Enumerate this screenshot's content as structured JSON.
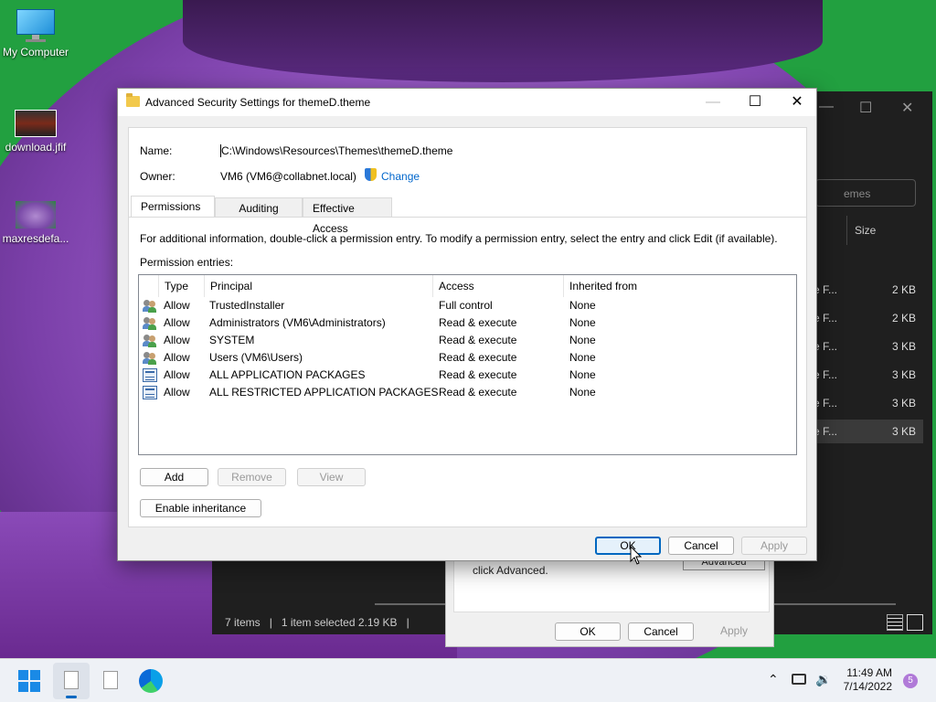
{
  "desktop": {
    "icons": [
      {
        "label": "My Computer"
      },
      {
        "label": "download.jfif"
      },
      {
        "label": "maxresdefa..."
      }
    ]
  },
  "explorer": {
    "search_placeholder": "emes",
    "size_header": "Size",
    "rows": [
      {
        "type": "e F...",
        "size": "2 KB"
      },
      {
        "type": "e F...",
        "size": "2 KB"
      },
      {
        "type": "e F...",
        "size": "3 KB"
      },
      {
        "type": "e F...",
        "size": "3 KB"
      },
      {
        "type": "e F...",
        "size": "3 KB"
      },
      {
        "type": "e F...",
        "size": "3 KB"
      }
    ],
    "status": {
      "items": "7 items",
      "selected": "1 item selected  2.19 KB"
    }
  },
  "properties": {
    "hint": "click Advanced.",
    "advanced_label": "Advanced",
    "ok_label": "OK",
    "cancel_label": "Cancel",
    "apply_label": "Apply"
  },
  "dialog": {
    "title": "Advanced Security Settings for themeD.theme",
    "name_label": "Name:",
    "name_value": "C:\\Windows\\Resources\\Themes\\themeD.theme",
    "owner_label": "Owner:",
    "owner_value": "VM6 (VM6@collabnet.local)",
    "change_label": "Change",
    "tabs": [
      "Permissions",
      "Auditing",
      "Effective Access"
    ],
    "info_text": "For additional information, double-click a permission entry. To modify a permission entry, select the entry and click Edit (if available).",
    "entries_label": "Permission entries:",
    "columns": [
      "Type",
      "Principal",
      "Access",
      "Inherited from"
    ],
    "entries": [
      {
        "icon": "users-icon",
        "type": "Allow",
        "principal": "TrustedInstaller",
        "access": "Full control",
        "inherited": "None"
      },
      {
        "icon": "users-icon",
        "type": "Allow",
        "principal": "Administrators (VM6\\Administrators)",
        "access": "Read & execute",
        "inherited": "None"
      },
      {
        "icon": "users-icon",
        "type": "Allow",
        "principal": "SYSTEM",
        "access": "Read & execute",
        "inherited": "None"
      },
      {
        "icon": "users-icon",
        "type": "Allow",
        "principal": "Users (VM6\\Users)",
        "access": "Read & execute",
        "inherited": "None"
      },
      {
        "icon": "package-icon",
        "type": "Allow",
        "principal": "ALL APPLICATION PACKAGES",
        "access": "Read & execute",
        "inherited": "None"
      },
      {
        "icon": "package-icon",
        "type": "Allow",
        "principal": "ALL RESTRICTED APPLICATION PACKAGES",
        "access": "Read & execute",
        "inherited": "None"
      }
    ],
    "add_label": "Add",
    "remove_label": "Remove",
    "view_label": "View",
    "enable_inheritance_label": "Enable inheritance",
    "ok_label": "OK",
    "cancel_label": "Cancel",
    "apply_label": "Apply"
  },
  "taskbar": {
    "time": "11:49 AM",
    "date": "7/14/2022",
    "notification_count": "5"
  },
  "colors": {
    "accent": "#0067c0",
    "change_link": "#0066cc"
  }
}
